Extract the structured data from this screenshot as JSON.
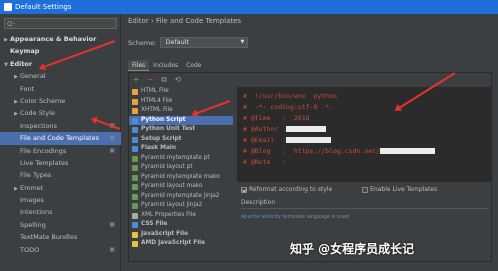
{
  "window": {
    "title": "Default Settings"
  },
  "search": {
    "placeholder": "Q-"
  },
  "tree": [
    {
      "label": "Appearance & Behavior",
      "arrow": "▶",
      "bold": true,
      "indent": 0
    },
    {
      "label": "Keymap",
      "arrow": "",
      "bold": true,
      "indent": 0
    },
    {
      "label": "Editor",
      "arrow": "▼",
      "bold": true,
      "indent": 0
    },
    {
      "label": "General",
      "arrow": "▶",
      "bold": false,
      "indent": 1
    },
    {
      "label": "Font",
      "arrow": "",
      "bold": false,
      "indent": 1
    },
    {
      "label": "Color Scheme",
      "arrow": "▶",
      "bold": false,
      "indent": 1
    },
    {
      "label": "Code Style",
      "arrow": "▶",
      "bold": false,
      "indent": 1
    },
    {
      "label": "Inspections",
      "arrow": "",
      "bold": false,
      "indent": 1
    },
    {
      "label": "File and Code Templates",
      "arrow": "",
      "bold": false,
      "indent": 1,
      "selected": true
    },
    {
      "label": "File Encodings",
      "arrow": "",
      "bold": false,
      "indent": 1
    },
    {
      "label": "Live Templates",
      "arrow": "",
      "bold": false,
      "indent": 1
    },
    {
      "label": "File Types",
      "arrow": "",
      "bold": false,
      "indent": 1
    },
    {
      "label": "Emmet",
      "arrow": "▶",
      "bold": false,
      "indent": 1
    },
    {
      "label": "Images",
      "arrow": "",
      "bold": false,
      "indent": 1
    },
    {
      "label": "Intentions",
      "arrow": "",
      "bold": false,
      "indent": 1
    },
    {
      "label": "Spelling",
      "arrow": "",
      "bold": false,
      "indent": 1
    },
    {
      "label": "TextMate Bundles",
      "arrow": "",
      "bold": false,
      "indent": 1
    },
    {
      "label": "TODO",
      "arrow": "",
      "bold": false,
      "indent": 1
    }
  ],
  "breadcrumb": {
    "parent": "Editor",
    "sep": "›",
    "current": "File and Code Templates"
  },
  "scheme": {
    "label": "Scheme:",
    "value": "Default"
  },
  "tabs": [
    "Files",
    "Includes",
    "Code"
  ],
  "toolbar": {
    "add": "+",
    "remove": "−",
    "copy": "⧉",
    "reset": "⟲"
  },
  "files": [
    {
      "label": "HTML File",
      "color": "#e8a33d",
      "bold": false
    },
    {
      "label": "HTML4 File",
      "color": "#e8a33d",
      "bold": false
    },
    {
      "label": "XHTML File",
      "color": "#e8a33d",
      "bold": false
    },
    {
      "label": "Python Script",
      "color": "#4a8fd6",
      "bold": true,
      "selected": true
    },
    {
      "label": "Python Unit Test",
      "color": "#4a8fd6",
      "bold": true
    },
    {
      "label": "Setup Script",
      "color": "#4a8fd6",
      "bold": true
    },
    {
      "label": "Flask Main",
      "color": "#4a8fd6",
      "bold": true
    },
    {
      "label": "Pyramid mytemplate pt",
      "color": "#6a9955",
      "bold": false
    },
    {
      "label": "Pyramid layout pt",
      "color": "#6a9955",
      "bold": false
    },
    {
      "label": "Pyramid mytemplate mako",
      "color": "#6a9955",
      "bold": false
    },
    {
      "label": "Pyramid layout mako",
      "color": "#6a9955",
      "bold": false
    },
    {
      "label": "Pyramid mytemplate jinja2",
      "color": "#6a9955",
      "bold": false
    },
    {
      "label": "Pyramid layout jinja2",
      "color": "#6a9955",
      "bold": false
    },
    {
      "label": "XML Properties File",
      "color": "#aaaaaa",
      "bold": false
    },
    {
      "label": "CSS File",
      "color": "#4a8fd6",
      "bold": true
    },
    {
      "label": "JavaScript File",
      "color": "#e8c33d",
      "bold": true
    },
    {
      "label": "AMD JavaScript File",
      "color": "#e8c33d",
      "bold": true
    }
  ],
  "code": [
    "#  !/usr/bin/env  python",
    "#  -*- coding:utf-8 -*-",
    "# @Time   :  2018",
    "# @Author :",
    "# @Email  :",
    "# @Blog   :  https://blog.csdn.net/",
    "# @Note   :"
  ],
  "options": {
    "reformat": "Reformat according to style",
    "live": "Enable Live Templates"
  },
  "description": {
    "label": "Description",
    "link": "Apache Velocity",
    "text": " template language is used"
  },
  "watermark": "知乎 @女程序员成长记"
}
